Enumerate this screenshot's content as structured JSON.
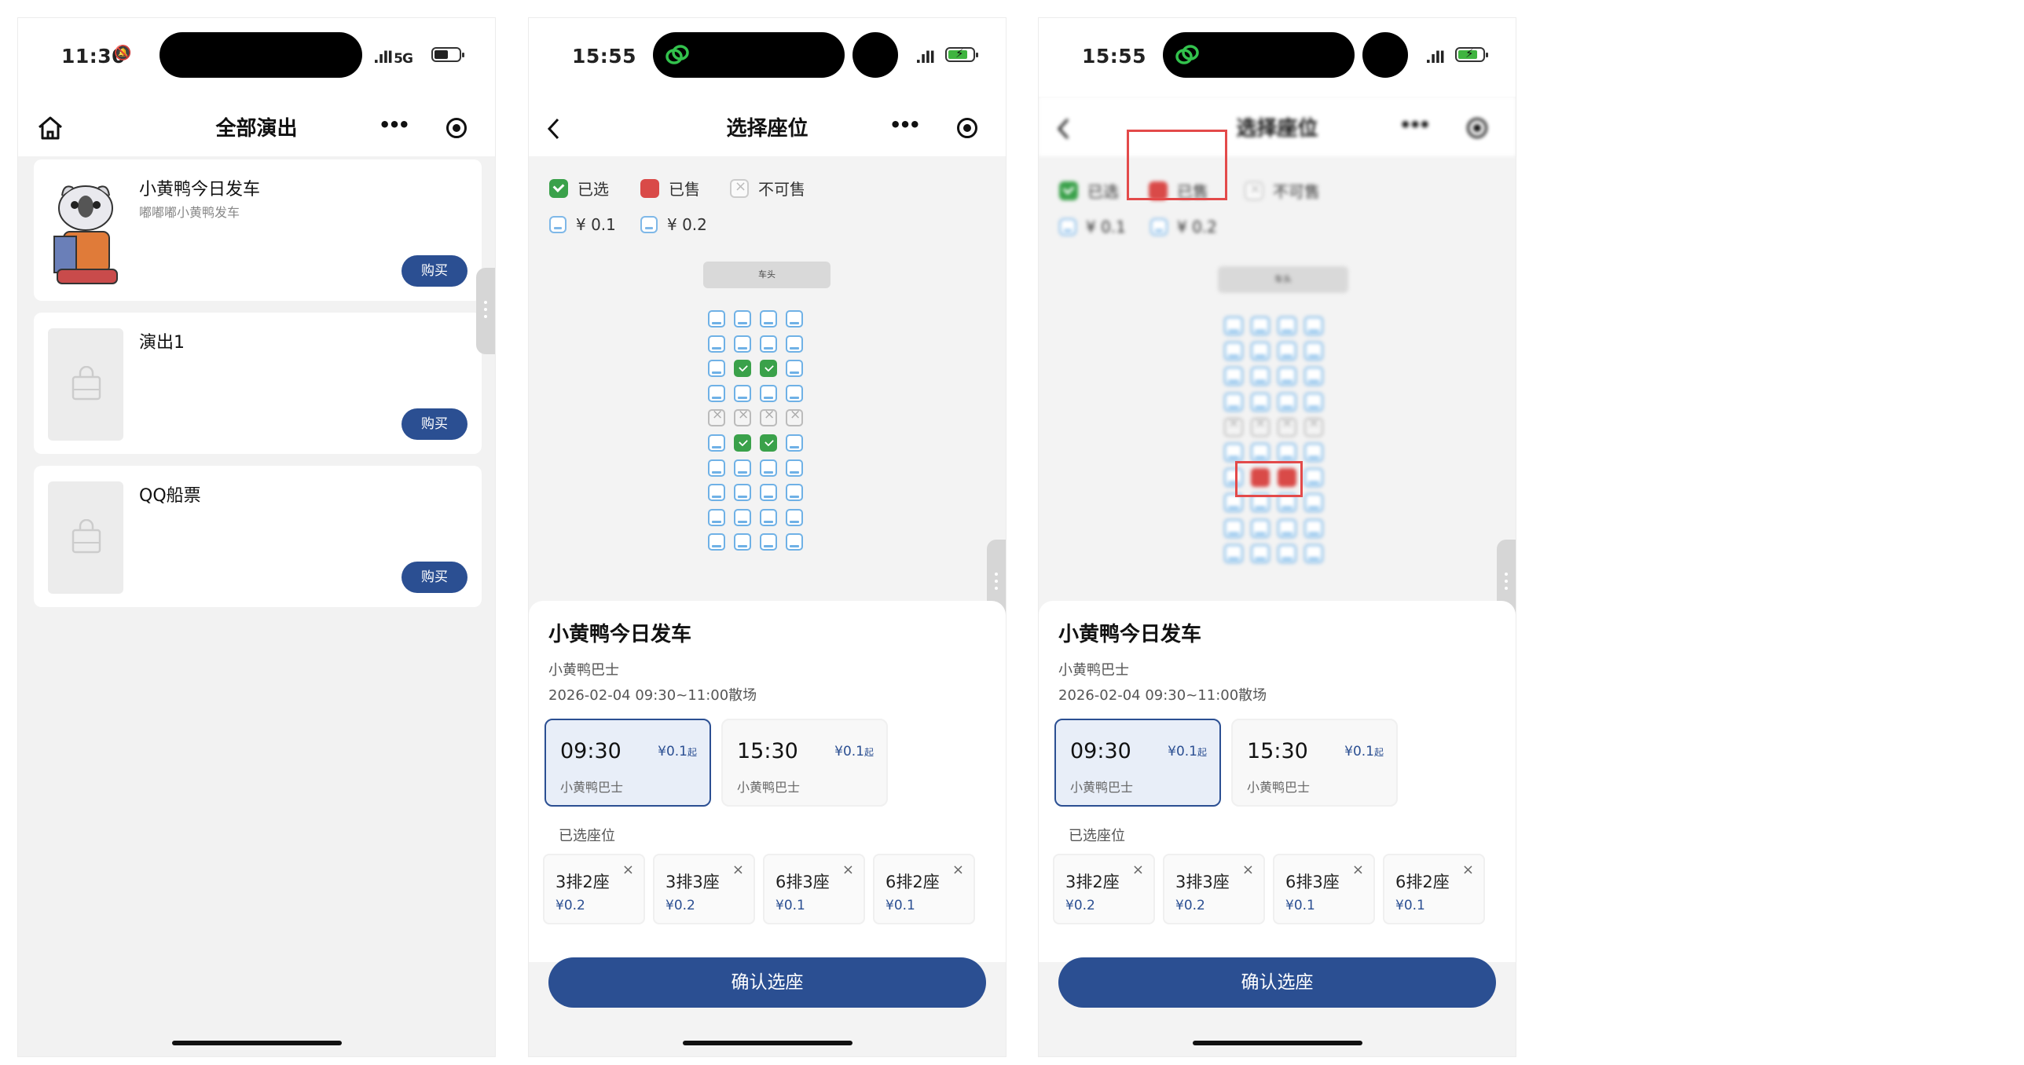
{
  "screen1": {
    "time": "11:30",
    "network": "5G",
    "nav_title": "全部演出",
    "shows": [
      {
        "title": "小黄鸭今日发车",
        "subtitle": "嘟嘟嘟小黄鸭发车",
        "buy_label": "购买"
      },
      {
        "title": "演出1",
        "subtitle": "",
        "buy_label": "购买"
      },
      {
        "title": "QQ船票",
        "subtitle": "",
        "buy_label": "购买"
      }
    ]
  },
  "seat_screen": {
    "time": "15:55",
    "nav_title": "选择座位",
    "legend": {
      "selected": "已选",
      "sold": "已售",
      "unavailable": "不可售",
      "price_a": "¥ 0.1",
      "price_b": "¥ 0.2"
    },
    "stage_label": "车头",
    "show_title": "小黄鸭今日发车",
    "venue": "小黄鸭巴士",
    "date": "2026-02-04 09:30~11:00散场",
    "sessions": [
      {
        "time": "09:30",
        "price": "¥0.1",
        "price_suffix": "起",
        "venue": "小黄鸭巴士",
        "active": true
      },
      {
        "time": "15:30",
        "price": "¥0.1",
        "price_suffix": "起",
        "venue": "小黄鸭巴士",
        "active": false
      }
    ],
    "selected_label": "已选座位",
    "selected_seats": [
      {
        "seat": "3排2座",
        "price": "¥0.2",
        "remove": "×"
      },
      {
        "seat": "3排3座",
        "price": "¥0.2",
        "remove": "×"
      },
      {
        "seat": "6排3座",
        "price": "¥0.1",
        "remove": "×"
      },
      {
        "seat": "6排2座",
        "price": "¥0.1",
        "remove": "×"
      }
    ],
    "confirm_label": "确认选座"
  },
  "seat_map_screen2": [
    [
      "p",
      "p",
      "p",
      "p"
    ],
    [
      "p",
      "p",
      "p",
      "p"
    ],
    [
      "p",
      "s",
      "s",
      "p"
    ],
    [
      "p",
      "p",
      "p",
      "p"
    ],
    [
      "n",
      "n",
      "n",
      "n"
    ],
    [
      "p",
      "s",
      "s",
      "p"
    ],
    [
      "p",
      "p",
      "p",
      "p"
    ],
    [
      "p",
      "p",
      "p",
      "p"
    ],
    [
      "p",
      "p",
      "p",
      "p"
    ],
    [
      "p",
      "p",
      "p",
      "p"
    ]
  ],
  "seat_map_screen3": [
    [
      "p",
      "p",
      "p",
      "p"
    ],
    [
      "p",
      "p",
      "p",
      "p"
    ],
    [
      "p",
      "p",
      "p",
      "p"
    ],
    [
      "p",
      "p",
      "p",
      "p"
    ],
    [
      "n",
      "n",
      "n",
      "n"
    ],
    [
      "p",
      "p",
      "p",
      "p"
    ],
    [
      "p",
      "x",
      "x",
      "p"
    ],
    [
      "p",
      "p",
      "p",
      "p"
    ],
    [
      "p",
      "p",
      "p",
      "p"
    ],
    [
      "p",
      "p",
      "p",
      "p"
    ]
  ],
  "colors": {
    "primary": "#2b4f92",
    "selected": "#3aa14a",
    "sold": "#d94a48",
    "highlight": "#e34a4a"
  }
}
